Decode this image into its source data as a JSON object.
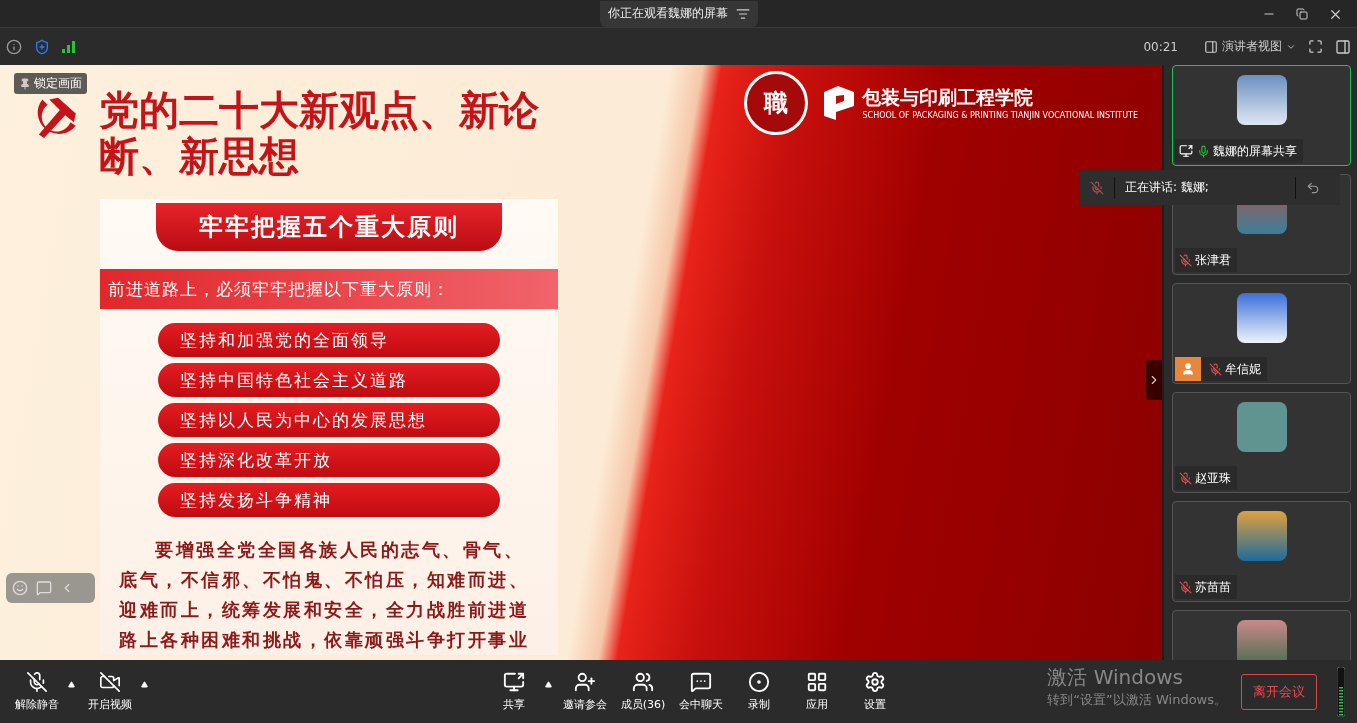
{
  "window": {
    "title": "你正在观看魏娜的屏幕"
  },
  "info_bar": {
    "timer": "00:21",
    "view_mode": "演讲者视图"
  },
  "overlay": {
    "lock_label": "锁定画面"
  },
  "slide": {
    "title": "党的二十大新观点、新论断、新思想",
    "logo_char": "職",
    "school_name": "包装与印刷工程学院",
    "school_subtitle": "SCHOOL OF PACKAGING & PRINTING TIANJIN VOCATIONAL INSTITUTE",
    "poster": {
      "heading": "牢牢把握五个重大原则",
      "lead": "前进道路上，必须牢牢把握以下重大原则：",
      "principles": [
        "坚持和加强党的全面领导",
        "坚持中国特色社会主义道路",
        "坚持以人民为中心的发展思想",
        "坚持深化改革开放",
        "坚持发扬斗争精神"
      ],
      "paragraph": "要增强全党全国各族人民的志气、骨气、底气，不信邪、不怕鬼、不怕压，知难而进、迎难而上，统筹发展和安全，全力战胜前进道路上各种困难和挑战，依靠顽强斗争打开事业"
    }
  },
  "speaking": {
    "text": "正在讲话: 魏娜;"
  },
  "participants": [
    {
      "name": "魏娜的屏幕共享",
      "muted": false,
      "sharing": true,
      "badge": false,
      "selected": true
    },
    {
      "name": "张津君",
      "muted": true,
      "sharing": false,
      "badge": false,
      "selected": false
    },
    {
      "name": "牟信妮",
      "muted": true,
      "sharing": false,
      "badge": true,
      "selected": false
    },
    {
      "name": "赵亚珠",
      "muted": true,
      "sharing": false,
      "badge": false,
      "selected": false
    },
    {
      "name": "苏苗苗",
      "muted": true,
      "sharing": false,
      "badge": false,
      "selected": false
    },
    {
      "selected": false
    }
  ],
  "toolbar": {
    "left": [
      {
        "label": "解除静音",
        "kind": "mic",
        "caret": true
      },
      {
        "label": "开启视频",
        "kind": "video",
        "caret": true
      }
    ],
    "center": [
      {
        "label": "共享",
        "kind": "share",
        "caret": true
      },
      {
        "label": "邀请参会",
        "kind": "invite",
        "caret": false
      },
      {
        "label": "成员(36)",
        "kind": "members",
        "caret": false
      },
      {
        "label": "会中聊天",
        "kind": "chat",
        "caret": false
      },
      {
        "label": "录制",
        "kind": "record",
        "caret": false
      },
      {
        "label": "应用",
        "kind": "apps",
        "caret": false
      },
      {
        "label": "设置",
        "kind": "settings",
        "caret": false
      }
    ],
    "leave": "离开会议"
  },
  "os_notice": {
    "title": "激活 Windows",
    "body": "转到“设置”以激活 Windows。"
  }
}
